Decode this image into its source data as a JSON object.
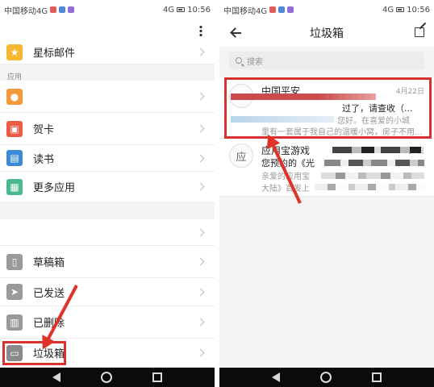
{
  "status_bar": {
    "carrier": "中国移动4G",
    "network": "4G",
    "time": "10:56"
  },
  "left_screen": {
    "menu_icon": "more-vertical-icon",
    "items_top": [
      {
        "label": "星标邮件",
        "icon": "star-icon",
        "color": "#f6b832"
      }
    ],
    "section_label": "应用",
    "apps": [
      {
        "label": "",
        "icon": "contact-icon",
        "color": "#f39a3a"
      },
      {
        "label": "贺卡",
        "icon": "card-icon",
        "color": "#ee5b45"
      },
      {
        "label": "读书",
        "icon": "book-icon",
        "color": "#3b8bd6"
      },
      {
        "label": "更多应用",
        "icon": "grid-icon",
        "color": "#49b98d"
      }
    ],
    "folders": [
      {
        "label": "",
        "icon": ""
      },
      {
        "label": "草稿箱",
        "icon": "draft-icon"
      },
      {
        "label": "已发送",
        "icon": "send-icon"
      },
      {
        "label": "已删除",
        "icon": "trash-icon"
      },
      {
        "label": "垃圾箱",
        "icon": "spam-box-icon"
      }
    ]
  },
  "right_screen": {
    "title": "垃圾箱",
    "search_placeholder": "搜索",
    "mails": [
      {
        "sender": "中国平安",
        "date": "4月22日",
        "subject": "过了，请查收（...",
        "preview_1": "您好。在喜爱的小城",
        "preview_2": "里有一套属于我自己的温暖小窝，房子不用..."
      },
      {
        "avatar": "应",
        "sender": "应用宝游戏",
        "date": "4月1日",
        "subject": "您预约的《光",
        "preview_1": "亲爱的应用宝",
        "preview_2": "大陆》首发上"
      }
    ]
  },
  "colors": {
    "highlight": "#d9312d",
    "nav_bar": "#0b0b0b"
  }
}
